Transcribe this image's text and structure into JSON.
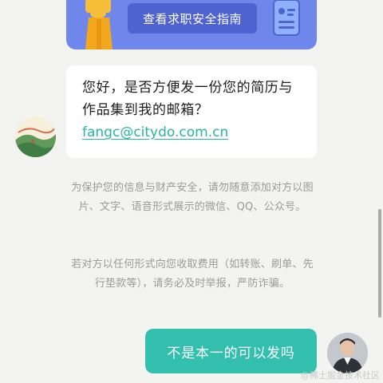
{
  "banner": {
    "button_label": "查看求职安全指南"
  },
  "chat": {
    "incoming_message": "您好，是否方便发一份您的简历与作品集到我的邮箱？",
    "incoming_email": "fangc@citydo.com.cn",
    "notices": [
      "为保护您的信息与财产安全，请勿随意添加对方以图片、文字、语音形式展示的微信、QQ、公众号。",
      "若对方以任何形式向您收取费用（如转账、刷单、先行垫款等），请务必及时举报，严防诈骗。"
    ],
    "outgoing_message": "不是本一的可以发吗"
  },
  "watermark": "@稀土掘金技术社区",
  "colors": {
    "accent": "#33bfae",
    "banner": "#6f86ea",
    "banner_button": "#4e63cf",
    "link": "#26b5a4"
  }
}
